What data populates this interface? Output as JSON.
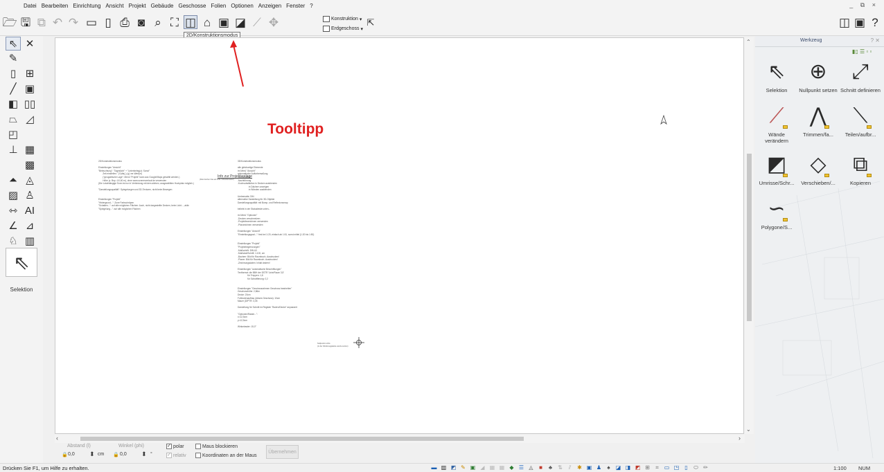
{
  "menu": [
    "Datei",
    "Bearbeiten",
    "Einrichtung",
    "Ansicht",
    "Projekt",
    "Gebäude",
    "Geschosse",
    "Folien",
    "Optionen",
    "Anzeigen",
    "Fenster",
    "?"
  ],
  "window_controls": "_ ⧉ ×",
  "toolbar": {
    "tooltip": "2D/Konstruktionsmodus",
    "combo_top": "Konstruktion",
    "combo_bottom": "Erdgeschoss",
    "icons": [
      "open-icon",
      "save-icon",
      "copy-icon",
      "undo-icon",
      "redo-icon",
      "layout-icon",
      "layout2-icon",
      "print-icon",
      "camera-icon",
      "zoom-icon",
      "fit-icon",
      "2d-mode-icon",
      "3d-mode-icon",
      "view-icon",
      "render-icon",
      "measure-icon",
      "move-icon"
    ]
  },
  "annotation": "Tooltipp",
  "left_palette": {
    "selected_label": "Selektion"
  },
  "document": {
    "title": "Info zur Projektvorlage",
    "subtitle": "(bitte löschen Sie auf Folie 'Infos/Hinweise')",
    "col1": "2D/Konstruktionsmodus\n\nEinstellungen \"Ansicht\"\n\"Beleuchtung\": \"Tageslicht\" + \"Linienbeleg(z): Sonst\"\n       Zeit einstellen: \"(Y)dts(-)-(y) ver-Wert(m)\n       (\"geografische Lage\": Menü \"Projekt\" kann aus Google/Maps gewählt werden.)\n       Höhe (z. Bsp. ∅0,60 m), ohne www.sonnenverlauf.de verwenden\n(Die Lotabhängige Sonn ist nur in Verbindung mit dem aktiven, ausgewählten Hochplatz möglich.)\n\n\"Darstellungsqualität\": Spiegelungen und 3D-Texturen, nicht beim Bewegen\n\n\nEinstellungen \"Projekt\"\n\"Hintergrund...\": Zone Farbschräpen\n\"Schatten...\": auf alle möglichen Flächen: Auch, nicht dargestellte Decken, beim Licht..., aktiv\n\"Spiegelung...\": auf alle möglichen Flächen",
    "col2": "3D/Konstruktionsmodus\n\nalle gleichartige Elemente\nim Menü \"Ansicht\"\nautomatische Auftorbemaßung\n-Umbemaßte\n-Nachführung\n-Kochsubstitution in Decken ausblenden\n                  in Dächern anzeigen\n                  in Wänden ausblenden\n\nUmbematte: DIN\nalternative Darstellung für 3D-Objekte\nDarstellungsqualität: mit Bump- und Reflexionsmap\n\nbeliebt in der Statusleiste unten...\n\nim Menü \"Optionen\"\n-Decken verschmelzen\n-Projektbezeichnen verwenden\n-Planzeichnen verwenden\n\nEinstellungen \"Ansicht\"\n\"Einstellungsgrad...\": fest bei 1:20, einfach ab 1:51, sonst mittel (1:20 bis 1:50)\n\n\nEinstellungen \"Projekt\"\n\"Projektbegrenzungen\"\n-Maßschrift: DIN A3\n-Maßstab/Schrift: 1:100, cm\n-Bauherr: Bild für Raumbuch- Ausdrucken!\n-Planer: Bild für Raumbuch- Ausdrucken!\n-Zeichnungsdaten: Inhalt ändern!\n\nEinstellungen \"automatische Beschriftungen\"\nTextformat: die BBH der DSTR 'Linie/Raum 3,5'\n                für Treppen: 1,8\n                für Schraffierung: 0,2\n\n\nEinstellungen \"Geschossrahmen Geschoss bearbeiten\"\nGeschosshöhe: 2,86m\nDecke: 20cm\nFußbodenaufbau (dieses Geschoss): 10cm\nMauer (DIPTR: 3,05\n\nDarstellung für Schnitt im Register \"Boden/Decke\" anpassen!\n\n\"Optionen/Raster...\":\nx=12,5cm\ny=12,5cm\n\nWinkelraster: 15,0°",
    "note": "Nullpunkt rechts\n(in der Werkzeugpalette werde setzen)"
  },
  "right_panel": {
    "title": "Werkzeug",
    "tools": [
      {
        "label": "Selektion",
        "icon": "selection-icon"
      },
      {
        "label": "Nullpunkt setzen",
        "icon": "origin-icon"
      },
      {
        "label": "Schnitt definieren",
        "icon": "section-icon"
      },
      {
        "label": "Wände verändern",
        "icon": "walls-modify-icon"
      },
      {
        "label": "Trimmen/fa...",
        "icon": "trim-icon"
      },
      {
        "label": "Teilen/aufbr...",
        "icon": "split-icon"
      },
      {
        "label": "Umrisse/Schr...",
        "icon": "outline-icon"
      },
      {
        "label": "Verschieben/...",
        "icon": "move-tool-icon"
      },
      {
        "label": "Kopieren",
        "icon": "copy-tool-icon"
      },
      {
        "label": "Polygone/S...",
        "icon": "polygon-icon"
      }
    ]
  },
  "input_bar": {
    "distance_label": "Abstand (l)",
    "distance_value": "0,0",
    "distance_unit": "cm",
    "angle_label": "Winkel (phi)",
    "angle_value": "0,0",
    "angle_unit": "°",
    "polar_label": "polar",
    "relative_label": "relativ",
    "block_mouse_label": "Maus blockieren",
    "coords_label": "Koordinaten an der Maus",
    "apply_label": "Übernehmen"
  },
  "status": {
    "hint": "Drücken Sie F1, um Hilfe zu erhalten.",
    "scale": "1:100",
    "mode": "NUM"
  }
}
